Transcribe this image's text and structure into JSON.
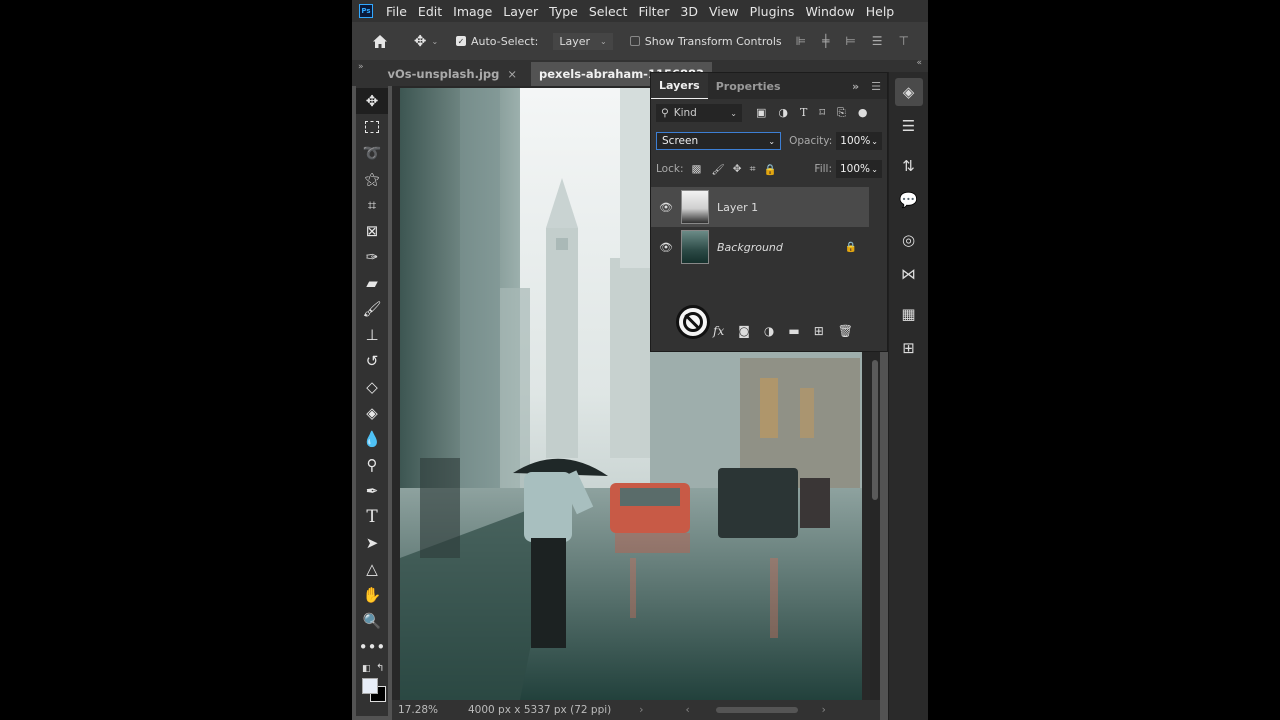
{
  "app": {
    "logo": "Ps",
    "menu": [
      "File",
      "Edit",
      "Image",
      "Layer",
      "Type",
      "Select",
      "Filter",
      "3D",
      "View",
      "Plugins",
      "Window",
      "Help"
    ]
  },
  "options": {
    "auto_select_label": "Auto-Select:",
    "auto_select_target": "Layer",
    "transform_label": "Show Transform Controls"
  },
  "tabs": [
    {
      "label": "vOs-unsplash.jpg",
      "close": "×"
    },
    {
      "label": "pexels-abraham-1156883"
    }
  ],
  "layers_panel": {
    "tabs": [
      "Layers",
      "Properties"
    ],
    "filter_kind": "Kind",
    "blend_mode": "Screen",
    "opacity_label": "Opacity:",
    "opacity_value": "100%",
    "lock_label": "Lock:",
    "fill_label": "Fill:",
    "fill_value": "100%",
    "layers": [
      {
        "name": "Layer 1",
        "selected": true
      },
      {
        "name": "Background",
        "locked": true
      }
    ],
    "fx_label": "fx"
  },
  "status": {
    "zoom": "17.28%",
    "doc_info": "4000 px x 5337 px (72 ppi)"
  },
  "colors": {
    "foreground": "#e8eef8",
    "background": "#000000",
    "accent": "#31a8ff"
  }
}
